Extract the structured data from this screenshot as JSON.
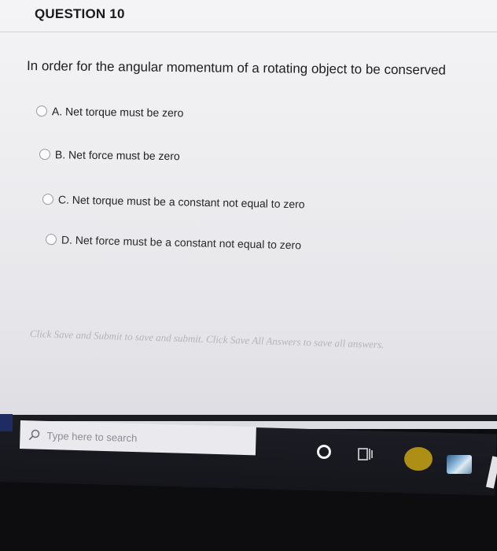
{
  "question": {
    "number_label": "QUESTION 10",
    "prompt": "In order for the angular momentum of a rotating object to be conserved",
    "options": [
      {
        "label": "A. Net torque must be zero"
      },
      {
        "label": "B. Net force must be zero"
      },
      {
        "label": "C. Net torque must be a constant not equal to zero"
      },
      {
        "label": "D. Net force must be a constant not equal to zero"
      }
    ]
  },
  "footer": {
    "instructions": "Click Save and Submit to save and submit. Click Save All Answers to save all answers."
  },
  "taskbar": {
    "search_placeholder": "Type here to search",
    "icons": [
      "search-icon",
      "cortana-icon",
      "task-view-icon",
      "file-explorer-icon",
      "store-icon"
    ]
  },
  "colors": {
    "page_background": "#ededf0",
    "text": "#1e1e1e",
    "radio_border": "#9a9aa4",
    "instruction_text": "#b3b3bd",
    "taskbar": "#17171e"
  }
}
